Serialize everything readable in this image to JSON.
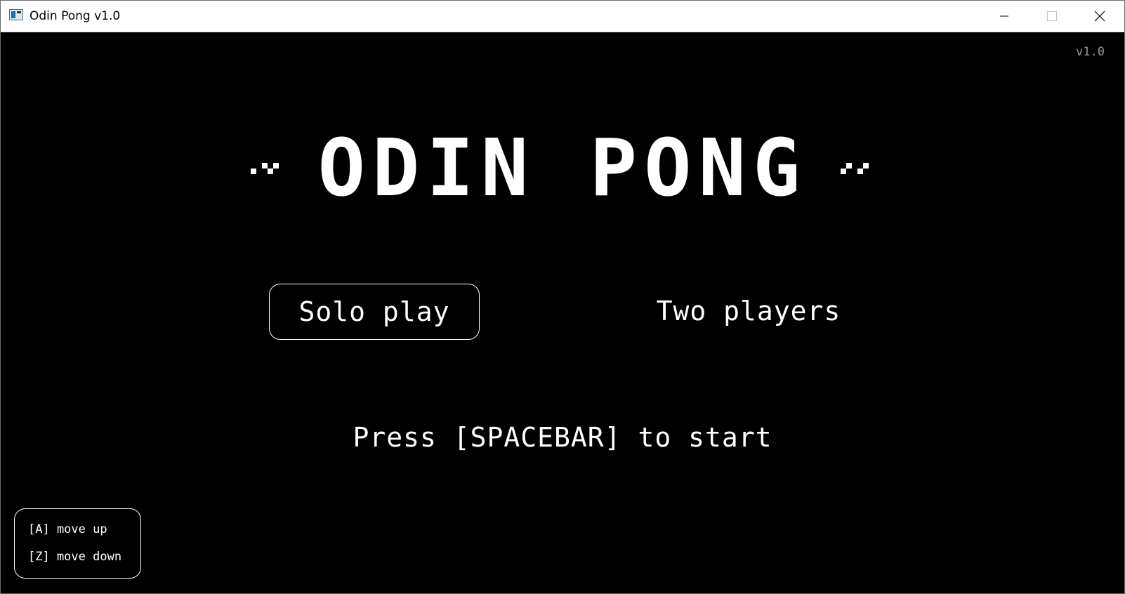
{
  "window": {
    "title": "Odin Pong v1.0"
  },
  "icons": {
    "app": "app-icon",
    "minimize": "minimize-icon",
    "maximize": "maximize-icon",
    "close": "close-icon"
  },
  "game": {
    "version": "v1.0",
    "title": "ODIN PONG",
    "modes": {
      "solo": "Solo play",
      "two": "Two players",
      "selected": "Solo play"
    },
    "prompt": "Press [SPACEBAR] to start",
    "controls": [
      "[A] move up",
      "[Z] move down"
    ]
  },
  "colors": {
    "background": "#000000",
    "foreground": "#ffffff",
    "version_text": "#9a9a9a"
  }
}
